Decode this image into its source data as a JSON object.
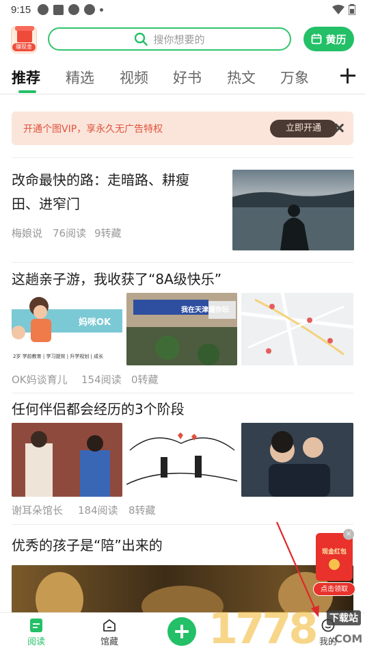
{
  "status_bar": {
    "time": "9:15"
  },
  "header": {
    "logo_badge_text": "赚现金",
    "search_placeholder": "搜你想要的",
    "almanac_label": "黄历"
  },
  "tabs": [
    {
      "label": "推荐",
      "active": true
    },
    {
      "label": "精选"
    },
    {
      "label": "视频"
    },
    {
      "label": "好书"
    },
    {
      "label": "热文"
    },
    {
      "label": "万象"
    }
  ],
  "vip_banner": {
    "text": "开通个图VIP，享永久无广告特权",
    "button_label": "立即开通"
  },
  "articles": [
    {
      "title_line1": "改命最快的路：走暗路、耕瘦",
      "title_line2": "田、进窄门",
      "author": "梅娘说",
      "reads": "76阅读",
      "reposts": "9转藏"
    },
    {
      "title": "这趟亲子游，我收获了“8A级快乐”",
      "author": "OK妈谈育儿",
      "reads": "154阅读",
      "reposts": "0转藏",
      "image1_text": "妈咪OK",
      "image1_sub": "2岁 学前教育 | 学习提效 | 升学规划 | 成长",
      "image2_text": "我在天津遛你玩"
    },
    {
      "title": "任何伴侣都会经历的3个阶段",
      "author": "谢耳朵馆长",
      "reads": "184阅读",
      "reposts": "8转藏"
    },
    {
      "title": "优秀的孩子是“陪”出来的"
    }
  ],
  "red_packet": {
    "title": "现金红包",
    "button": "点击领取"
  },
  "bottom_nav": {
    "read": "阅读",
    "library": "馆藏",
    "me": "我的"
  },
  "watermark": {
    "text": "1778",
    "badge": "下载站",
    "suffix": ".COM"
  },
  "colors": {
    "accent": "#23c067",
    "vip_bg": "#fbe5da",
    "vip_text": "#e0523f",
    "red_packet": "#e8322b"
  }
}
